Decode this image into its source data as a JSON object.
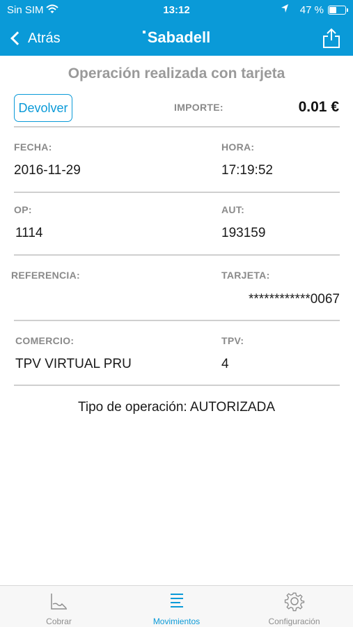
{
  "status_bar": {
    "carrier": "Sin SIM",
    "time": "13:12",
    "battery_percent": "47 %",
    "battery_level": 0.47
  },
  "nav": {
    "back_label": "Atrás",
    "brand": "Sabadell"
  },
  "page_title": "Operación realizada con tarjeta",
  "return_button_label": "Devolver",
  "amount": {
    "label": "IMPORTE:",
    "value": "0.01 €"
  },
  "fields": {
    "fecha": {
      "label": "FECHA:",
      "value": "2016-11-29"
    },
    "hora": {
      "label": "HORA:",
      "value": "17:19:52"
    },
    "op": {
      "label": "OP:",
      "value": "1114"
    },
    "aut": {
      "label": "AUT:",
      "value": "193159"
    },
    "referencia": {
      "label": "REFERENCIA:",
      "value": ""
    },
    "tarjeta": {
      "label": "TARJETA:",
      "value": "************0067"
    },
    "comercio": {
      "label": "COMERCIO:",
      "value": "TPV VIRTUAL PRU"
    },
    "tpv": {
      "label": "TPV:",
      "value": "4"
    }
  },
  "operation_type": "Tipo de operación: AUTORIZADA",
  "tab_bar": {
    "tabs": [
      {
        "label": "Cobrar",
        "icon": "chart-icon",
        "active": false
      },
      {
        "label": "Movimientos",
        "icon": "list-icon",
        "active": true
      },
      {
        "label": "Configuración",
        "icon": "gear-icon",
        "active": false
      }
    ]
  },
  "colors": {
    "brand_blue": "#0a9ad8",
    "label_gray": "#8a8a8a",
    "divider_gray": "#cfcfcf"
  }
}
